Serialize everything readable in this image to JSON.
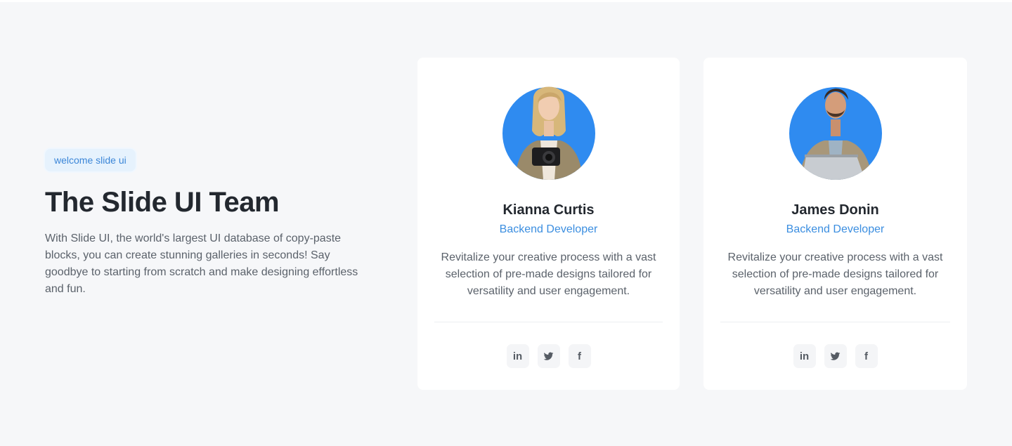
{
  "intro": {
    "badge": "welcome slide ui",
    "title": "The Slide UI Team",
    "description": "With Slide UI, the world's largest UI database of copy-paste blocks, you can create stunning galleries in seconds! Say goodbye to starting from scratch and make designing effortless and fun."
  },
  "members": [
    {
      "name": "Kianna Curtis",
      "role": "Backend Developer",
      "bio": "Revitalize your creative process with a vast selection of pre-made designs tailored for versatility and user engagement.",
      "socials": [
        {
          "label": "in",
          "icon": "linkedin-icon"
        },
        {
          "label": "",
          "icon": "twitter-icon"
        },
        {
          "label": "f",
          "icon": "facebook-icon"
        }
      ]
    },
    {
      "name": "James Donin",
      "role": "Backend Developer",
      "bio": "Revitalize your creative process with a vast selection of pre-made designs tailored for versatility and user engagement.",
      "socials": [
        {
          "label": "in",
          "icon": "linkedin-icon"
        },
        {
          "label": "",
          "icon": "twitter-icon"
        },
        {
          "label": "f",
          "icon": "facebook-icon"
        }
      ]
    }
  ],
  "colors": {
    "accent": "#3b8ee0",
    "avatar_bg": "#2f8bf0",
    "page_bg": "#f6f7f9"
  }
}
